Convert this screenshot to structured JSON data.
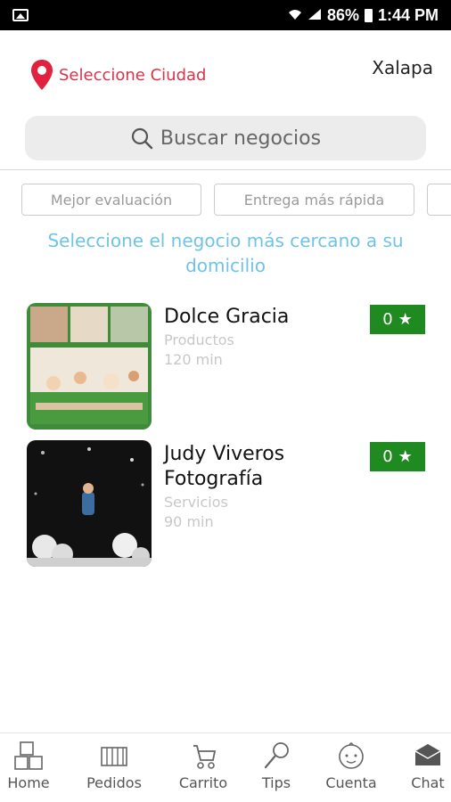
{
  "status_bar": {
    "battery": "86%",
    "time": "1:44 PM"
  },
  "header": {
    "city_select_label": "Seleccione Ciudad",
    "current_city": "Xalapa"
  },
  "search": {
    "placeholder": "Buscar negocios"
  },
  "filters": [
    "Mejor evaluación",
    "Entrega más rápida",
    ""
  ],
  "prompt": "Seleccione el negocio más cercano a su domicilio",
  "businesses": [
    {
      "name": "Dolce Gracia",
      "category": "Productos",
      "time": "120 min",
      "rating": "0"
    },
    {
      "name": "Judy Viveros Fotografía",
      "category": "Servicios",
      "time": "90 min",
      "rating": "0"
    }
  ],
  "rating_star": "★",
  "nav": [
    "Home",
    "Pedidos",
    "Carrito",
    "Tips",
    "Cuenta",
    "Chat"
  ],
  "icons": [
    "image-icon",
    "wifi-icon",
    "signal-icon",
    "battery-icon",
    "location-pin-icon",
    "search-icon",
    "star-icon",
    "blocks-icon",
    "crib-icon",
    "stroller-icon",
    "rattle-icon",
    "baby-face-icon",
    "chat-icon"
  ],
  "colors": {
    "accent_red": "#d6344a",
    "prompt_blue": "#6fc3e6",
    "rating_green": "#1f8a1f"
  }
}
